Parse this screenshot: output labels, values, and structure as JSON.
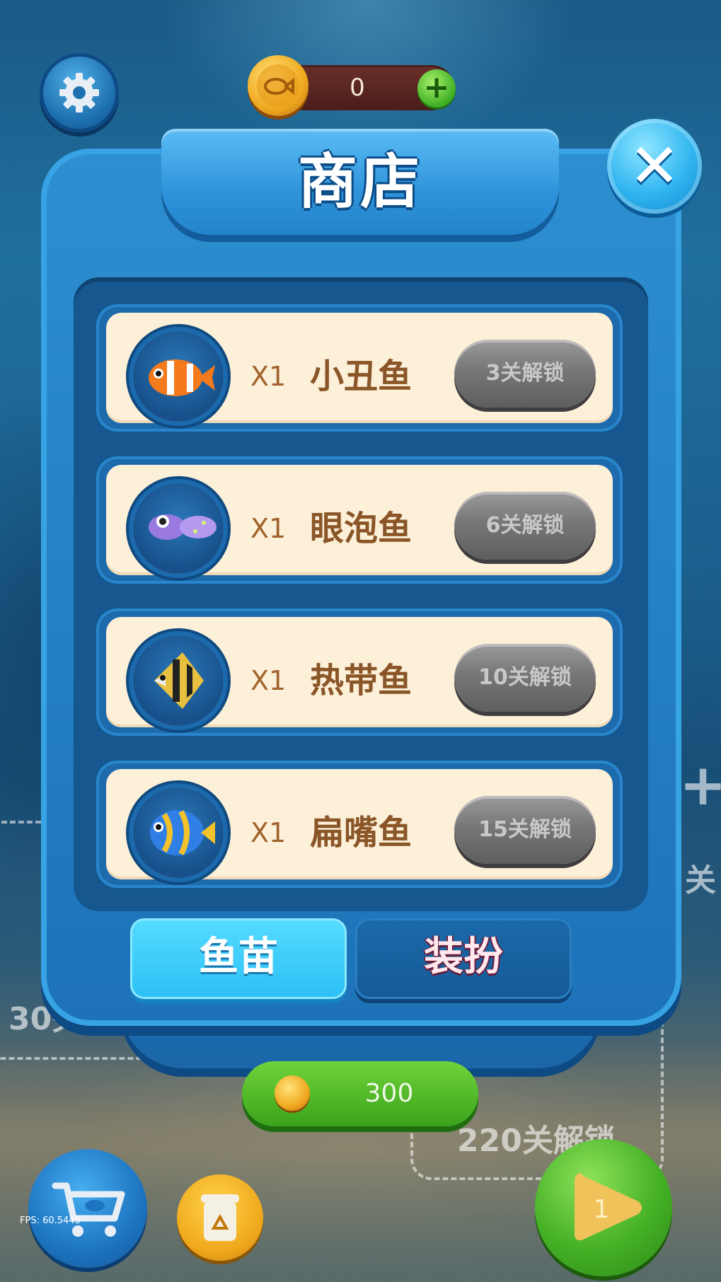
{
  "hud": {
    "coins": "0",
    "fps": "FPS: 60.5445"
  },
  "shop": {
    "title": "商店",
    "items": [
      {
        "qty": "X1",
        "name": "小丑鱼",
        "unlock": "3关解锁",
        "icon": "clownfish-icon"
      },
      {
        "qty": "X1",
        "name": "眼泡鱼",
        "unlock": "6关解锁",
        "icon": "bubble-eye-fish-icon"
      },
      {
        "qty": "X1",
        "name": "热带鱼",
        "unlock": "10关解锁",
        "icon": "tropical-fish-icon"
      },
      {
        "qty": "X1",
        "name": "扁嘴鱼",
        "unlock": "15关解锁",
        "icon": "flat-mouth-fish-icon"
      }
    ],
    "tabs": [
      {
        "label": "鱼苗",
        "active": true
      },
      {
        "label": "装扮",
        "active": false
      }
    ]
  },
  "background": {
    "left_label": "30关",
    "right_label": "关",
    "bottom_label": "220关解锁"
  },
  "bottom": {
    "price": "300",
    "level": "1"
  },
  "colors": {
    "panel": "#1d72b8",
    "active_tab": "#3ccdfa",
    "unlock_button": "#777777",
    "item_bg": "#fdf0d8"
  }
}
